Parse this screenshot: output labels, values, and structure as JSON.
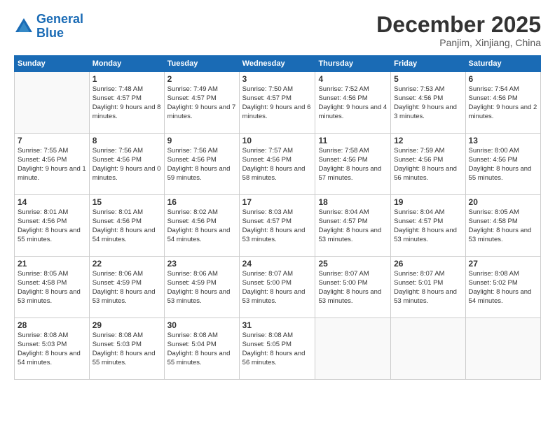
{
  "logo": {
    "line1": "General",
    "line2": "Blue"
  },
  "title": "December 2025",
  "subtitle": "Panjim, Xinjiang, China",
  "header_days": [
    "Sunday",
    "Monday",
    "Tuesday",
    "Wednesday",
    "Thursday",
    "Friday",
    "Saturday"
  ],
  "weeks": [
    [
      {
        "day": "",
        "sunrise": "",
        "sunset": "",
        "daylight": ""
      },
      {
        "day": "1",
        "sunrise": "Sunrise: 7:48 AM",
        "sunset": "Sunset: 4:57 PM",
        "daylight": "Daylight: 9 hours and 8 minutes."
      },
      {
        "day": "2",
        "sunrise": "Sunrise: 7:49 AM",
        "sunset": "Sunset: 4:57 PM",
        "daylight": "Daylight: 9 hours and 7 minutes."
      },
      {
        "day": "3",
        "sunrise": "Sunrise: 7:50 AM",
        "sunset": "Sunset: 4:57 PM",
        "daylight": "Daylight: 9 hours and 6 minutes."
      },
      {
        "day": "4",
        "sunrise": "Sunrise: 7:52 AM",
        "sunset": "Sunset: 4:56 PM",
        "daylight": "Daylight: 9 hours and 4 minutes."
      },
      {
        "day": "5",
        "sunrise": "Sunrise: 7:53 AM",
        "sunset": "Sunset: 4:56 PM",
        "daylight": "Daylight: 9 hours and 3 minutes."
      },
      {
        "day": "6",
        "sunrise": "Sunrise: 7:54 AM",
        "sunset": "Sunset: 4:56 PM",
        "daylight": "Daylight: 9 hours and 2 minutes."
      }
    ],
    [
      {
        "day": "7",
        "sunrise": "Sunrise: 7:55 AM",
        "sunset": "Sunset: 4:56 PM",
        "daylight": "Daylight: 9 hours and 1 minute."
      },
      {
        "day": "8",
        "sunrise": "Sunrise: 7:56 AM",
        "sunset": "Sunset: 4:56 PM",
        "daylight": "Daylight: 9 hours and 0 minutes."
      },
      {
        "day": "9",
        "sunrise": "Sunrise: 7:56 AM",
        "sunset": "Sunset: 4:56 PM",
        "daylight": "Daylight: 8 hours and 59 minutes."
      },
      {
        "day": "10",
        "sunrise": "Sunrise: 7:57 AM",
        "sunset": "Sunset: 4:56 PM",
        "daylight": "Daylight: 8 hours and 58 minutes."
      },
      {
        "day": "11",
        "sunrise": "Sunrise: 7:58 AM",
        "sunset": "Sunset: 4:56 PM",
        "daylight": "Daylight: 8 hours and 57 minutes."
      },
      {
        "day": "12",
        "sunrise": "Sunrise: 7:59 AM",
        "sunset": "Sunset: 4:56 PM",
        "daylight": "Daylight: 8 hours and 56 minutes."
      },
      {
        "day": "13",
        "sunrise": "Sunrise: 8:00 AM",
        "sunset": "Sunset: 4:56 PM",
        "daylight": "Daylight: 8 hours and 55 minutes."
      }
    ],
    [
      {
        "day": "14",
        "sunrise": "Sunrise: 8:01 AM",
        "sunset": "Sunset: 4:56 PM",
        "daylight": "Daylight: 8 hours and 55 minutes."
      },
      {
        "day": "15",
        "sunrise": "Sunrise: 8:01 AM",
        "sunset": "Sunset: 4:56 PM",
        "daylight": "Daylight: 8 hours and 54 minutes."
      },
      {
        "day": "16",
        "sunrise": "Sunrise: 8:02 AM",
        "sunset": "Sunset: 4:56 PM",
        "daylight": "Daylight: 8 hours and 54 minutes."
      },
      {
        "day": "17",
        "sunrise": "Sunrise: 8:03 AM",
        "sunset": "Sunset: 4:57 PM",
        "daylight": "Daylight: 8 hours and 53 minutes."
      },
      {
        "day": "18",
        "sunrise": "Sunrise: 8:04 AM",
        "sunset": "Sunset: 4:57 PM",
        "daylight": "Daylight: 8 hours and 53 minutes."
      },
      {
        "day": "19",
        "sunrise": "Sunrise: 8:04 AM",
        "sunset": "Sunset: 4:57 PM",
        "daylight": "Daylight: 8 hours and 53 minutes."
      },
      {
        "day": "20",
        "sunrise": "Sunrise: 8:05 AM",
        "sunset": "Sunset: 4:58 PM",
        "daylight": "Daylight: 8 hours and 53 minutes."
      }
    ],
    [
      {
        "day": "21",
        "sunrise": "Sunrise: 8:05 AM",
        "sunset": "Sunset: 4:58 PM",
        "daylight": "Daylight: 8 hours and 53 minutes."
      },
      {
        "day": "22",
        "sunrise": "Sunrise: 8:06 AM",
        "sunset": "Sunset: 4:59 PM",
        "daylight": "Daylight: 8 hours and 53 minutes."
      },
      {
        "day": "23",
        "sunrise": "Sunrise: 8:06 AM",
        "sunset": "Sunset: 4:59 PM",
        "daylight": "Daylight: 8 hours and 53 minutes."
      },
      {
        "day": "24",
        "sunrise": "Sunrise: 8:07 AM",
        "sunset": "Sunset: 5:00 PM",
        "daylight": "Daylight: 8 hours and 53 minutes."
      },
      {
        "day": "25",
        "sunrise": "Sunrise: 8:07 AM",
        "sunset": "Sunset: 5:00 PM",
        "daylight": "Daylight: 8 hours and 53 minutes."
      },
      {
        "day": "26",
        "sunrise": "Sunrise: 8:07 AM",
        "sunset": "Sunset: 5:01 PM",
        "daylight": "Daylight: 8 hours and 53 minutes."
      },
      {
        "day": "27",
        "sunrise": "Sunrise: 8:08 AM",
        "sunset": "Sunset: 5:02 PM",
        "daylight": "Daylight: 8 hours and 54 minutes."
      }
    ],
    [
      {
        "day": "28",
        "sunrise": "Sunrise: 8:08 AM",
        "sunset": "Sunset: 5:03 PM",
        "daylight": "Daylight: 8 hours and 54 minutes."
      },
      {
        "day": "29",
        "sunrise": "Sunrise: 8:08 AM",
        "sunset": "Sunset: 5:03 PM",
        "daylight": "Daylight: 8 hours and 55 minutes."
      },
      {
        "day": "30",
        "sunrise": "Sunrise: 8:08 AM",
        "sunset": "Sunset: 5:04 PM",
        "daylight": "Daylight: 8 hours and 55 minutes."
      },
      {
        "day": "31",
        "sunrise": "Sunrise: 8:08 AM",
        "sunset": "Sunset: 5:05 PM",
        "daylight": "Daylight: 8 hours and 56 minutes."
      },
      {
        "day": "",
        "sunrise": "",
        "sunset": "",
        "daylight": ""
      },
      {
        "day": "",
        "sunrise": "",
        "sunset": "",
        "daylight": ""
      },
      {
        "day": "",
        "sunrise": "",
        "sunset": "",
        "daylight": ""
      }
    ]
  ]
}
